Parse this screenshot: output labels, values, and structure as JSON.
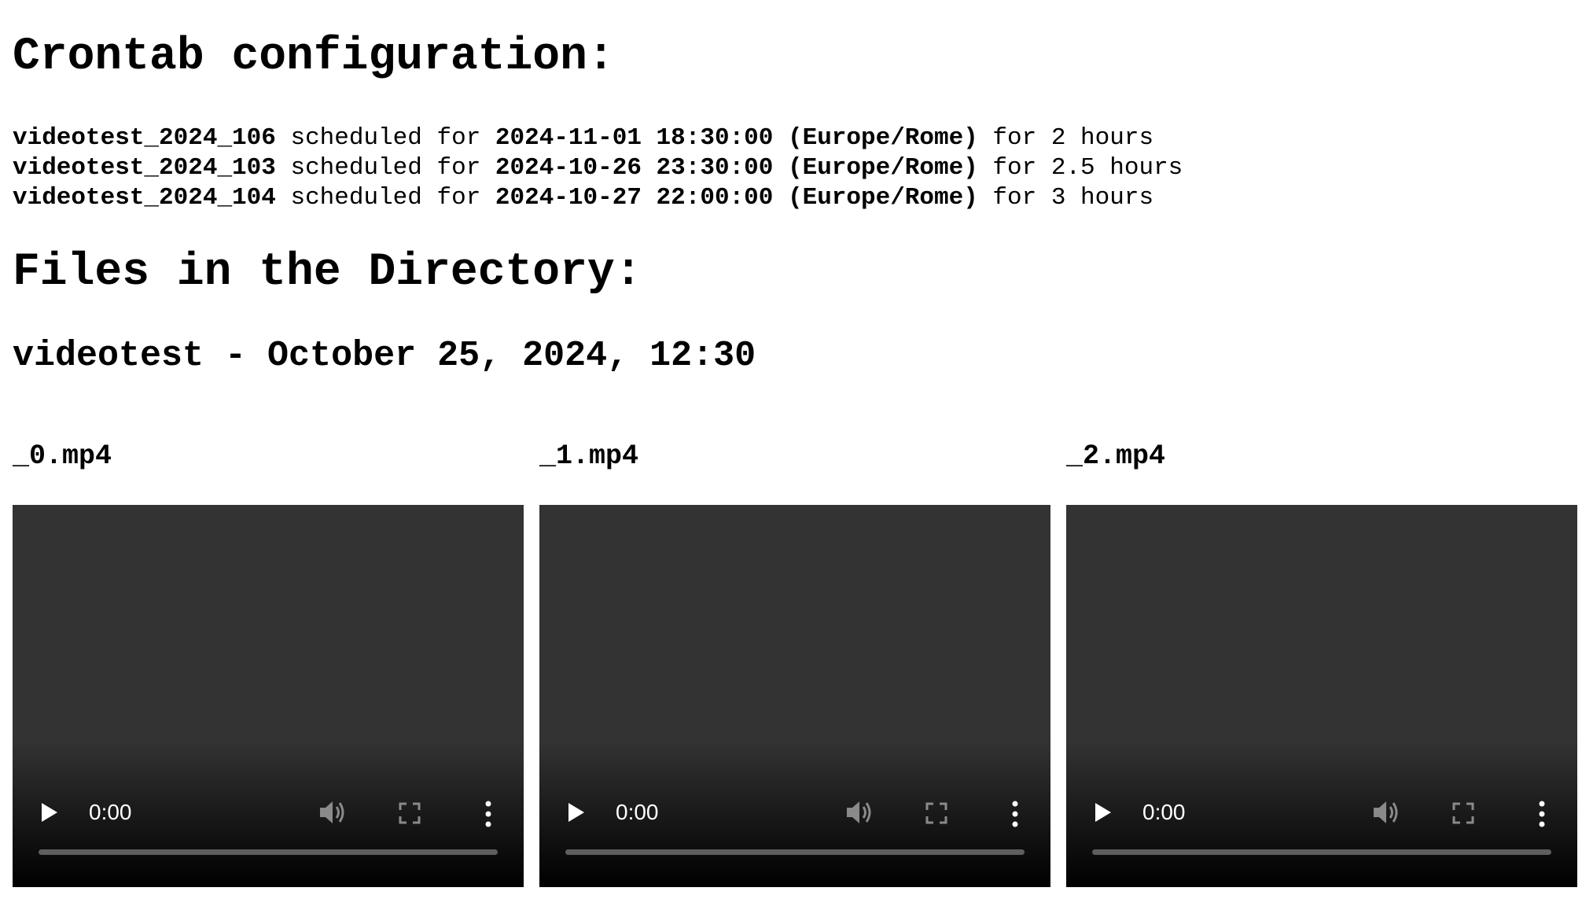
{
  "headings": {
    "crontab": "Crontab configuration:",
    "files": "Files in the Directory:"
  },
  "crontab": [
    {
      "name": "videotest_2024_106",
      "mid": " scheduled for ",
      "datetime": "2024-11-01 18:30:00",
      "tz": "(Europe/Rome)",
      "duration": " for 2 hours"
    },
    {
      "name": "videotest_2024_103",
      "mid": " scheduled for ",
      "datetime": "2024-10-26 23:30:00",
      "tz": "(Europe/Rome)",
      "duration": " for 2.5 hours"
    },
    {
      "name": "videotest_2024_104",
      "mid": " scheduled for ",
      "datetime": "2024-10-27 22:00:00",
      "tz": "(Europe/Rome)",
      "duration": " for 3 hours"
    }
  ],
  "directory": {
    "title": "videotest - October 25, 2024, 12:30",
    "files": [
      {
        "label": "_0.mp4",
        "time": "0:00"
      },
      {
        "label": "_1.mp4",
        "time": "0:00"
      },
      {
        "label": "_2.mp4",
        "time": "0:00"
      }
    ]
  },
  "icons": {
    "play": "play-icon",
    "volume": "volume-icon",
    "fullscreen": "fullscreen-icon",
    "more": "more-options-icon"
  },
  "colors": {
    "video_bg_top": "#333333",
    "video_bg_bottom": "#000000",
    "progress_track": "#5f5f5f",
    "control_icon": "#ffffff",
    "control_icon_dim": "#8a8a8a"
  }
}
